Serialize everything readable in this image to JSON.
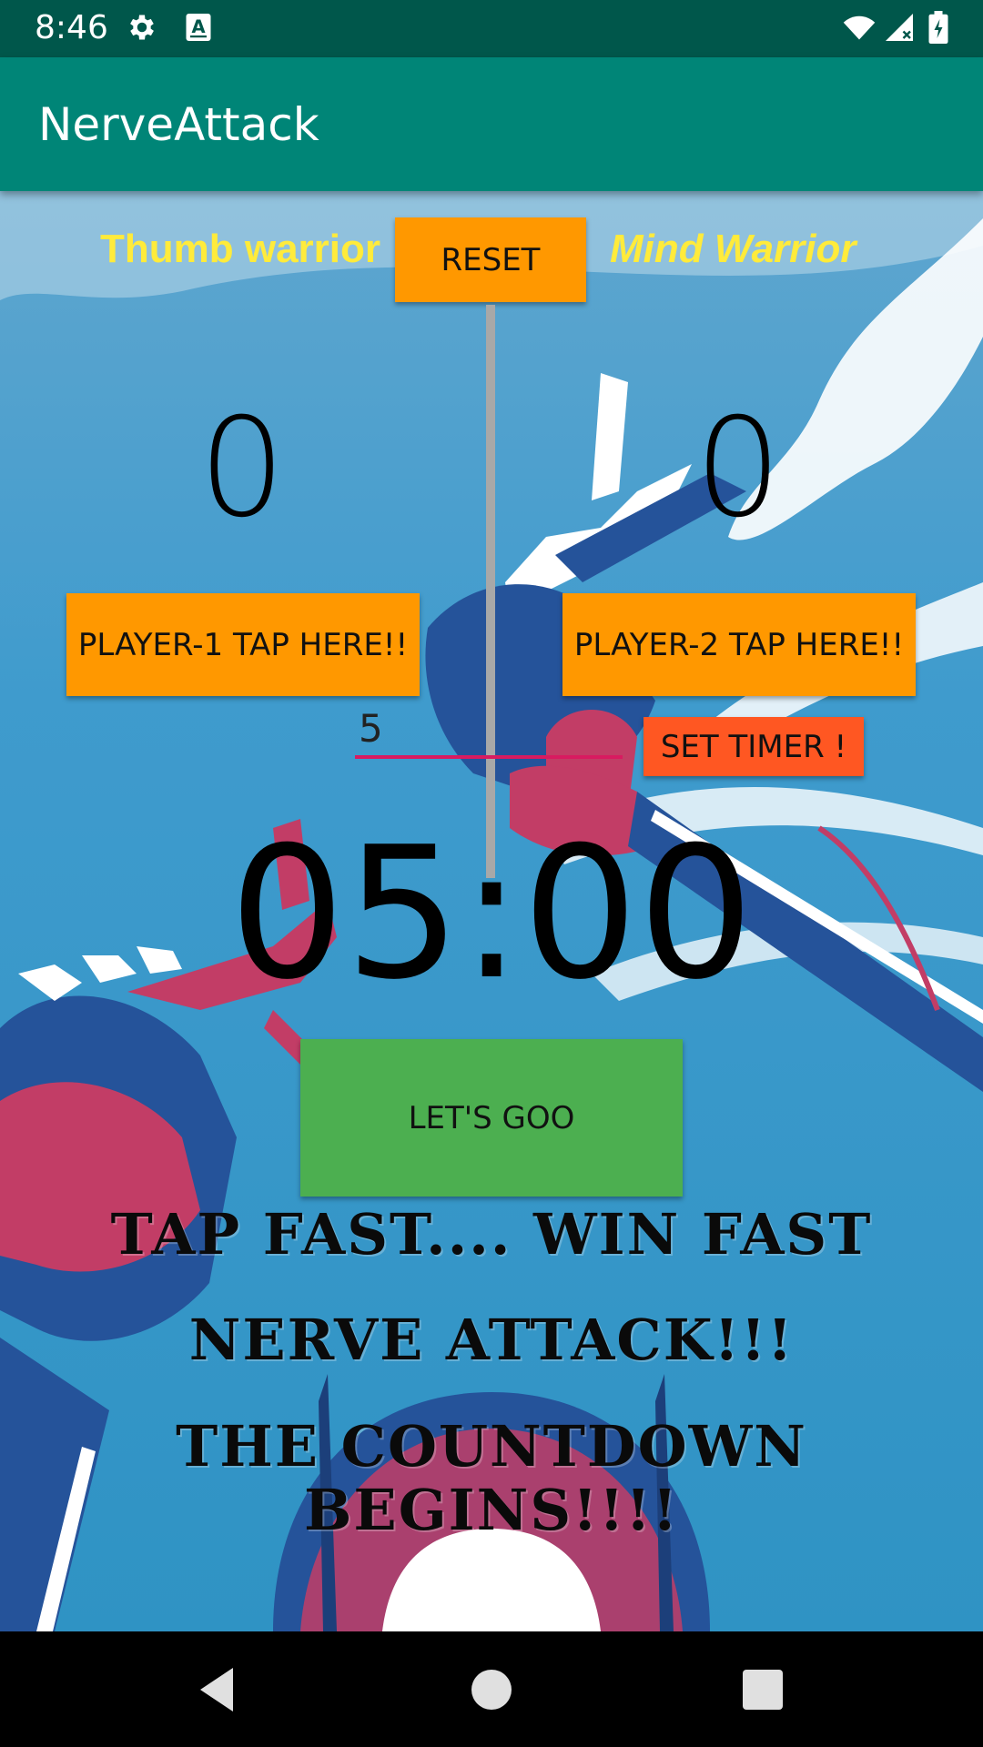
{
  "status_bar": {
    "time": "8:46",
    "icons_left": [
      "gear-icon",
      "a-box-icon"
    ],
    "icons_right": [
      "wifi-icon",
      "signal-icon",
      "battery-icon"
    ]
  },
  "app_bar": {
    "title": "NerveAttack"
  },
  "game": {
    "player1_name": "Thumb warrior",
    "player2_name": "Mind Warrior",
    "reset_label": "RESET",
    "player1_score": "0",
    "player2_score": "0",
    "player1_tap_label": "PLAYER-1 TAP HERE!!",
    "player2_tap_label": "PLAYER-2 TAP HERE!!",
    "timer_input_value": "5",
    "set_timer_label": "SET TIMER !",
    "countdown": "05:00",
    "start_label": "LET'S GOO",
    "slogan_1": "TAP FAST.... WIN FAST",
    "slogan_2": "NERVE ATTACK!!!",
    "slogan_3": "THE COUNTDOWN BEGINS!!!!"
  },
  "colors": {
    "status_bar": "#00574b",
    "app_bar": "#008577",
    "orange_button": "#ff9800",
    "set_timer_button": "#ff5722",
    "go_button": "#4caf50",
    "player_name": "#ffeb3b",
    "input_underline": "#d81b60"
  },
  "nav_bar": {
    "icons": [
      "back-icon",
      "home-icon",
      "recents-icon"
    ]
  }
}
